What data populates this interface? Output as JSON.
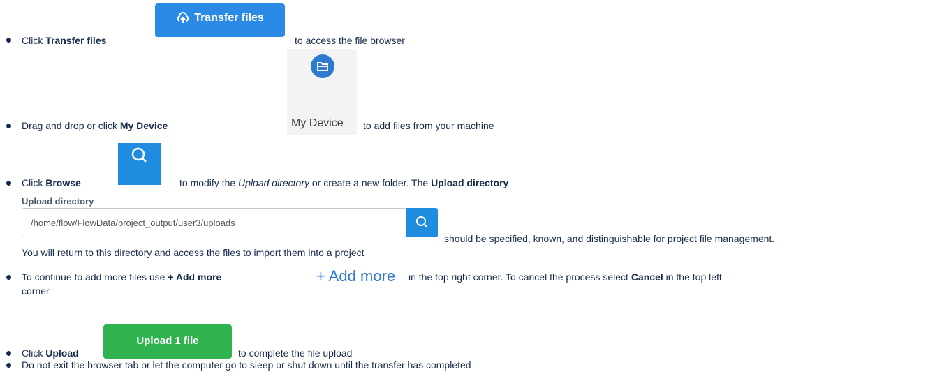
{
  "steps": [
    {
      "before": "Click ",
      "bold": "Transfer files",
      "after": " to access the file browser"
    },
    {
      "before": "Drag and drop or click ",
      "bold": "My Device",
      "after": " to add files from your machine"
    },
    {
      "before": "Click ",
      "bold": "Browse",
      "middle1": " to modify the ",
      "italic": "Upload directory",
      "middle2": " or create a new folder. The ",
      "bold2": "Upload directory",
      "after": " should be specified, known, and distinguishable for project file management.",
      "line2": "You will return to this directory and access the files to import them into a project"
    },
    {
      "before": "To continue to add more files use ",
      "bold": "+ Add more",
      "middle": " in the top right corner. To cancel the process select ",
      "bold2": "Cancel",
      "after": " in the top left",
      "line2": "corner"
    },
    {
      "before": "Click ",
      "bold": "Upload",
      "after": " to complete the file upload"
    },
    {
      "text": "Do not exit the browser tab or let the computer go to sleep or shut down until the transfer has completed"
    }
  ],
  "widgets": {
    "transfer_files_label": "Transfer files",
    "my_device_label": "My Device",
    "upload_directory_label": "Upload directory",
    "upload_directory_value": "/home/flow/FlowData/project_output/user3/uploads",
    "add_more_label": "+ Add more",
    "upload_button_label": "Upload 1 file"
  },
  "colors": {
    "transfer_button": "#2b8ae6",
    "browse_button": "#1f8ce0",
    "upload_button": "#2fb34e",
    "link_blue": "#2f7ad1"
  },
  "icons": {
    "transfer": "cloud-upload-icon",
    "device": "folder-icon",
    "browse": "search-icon",
    "directory_search": "search-icon"
  }
}
